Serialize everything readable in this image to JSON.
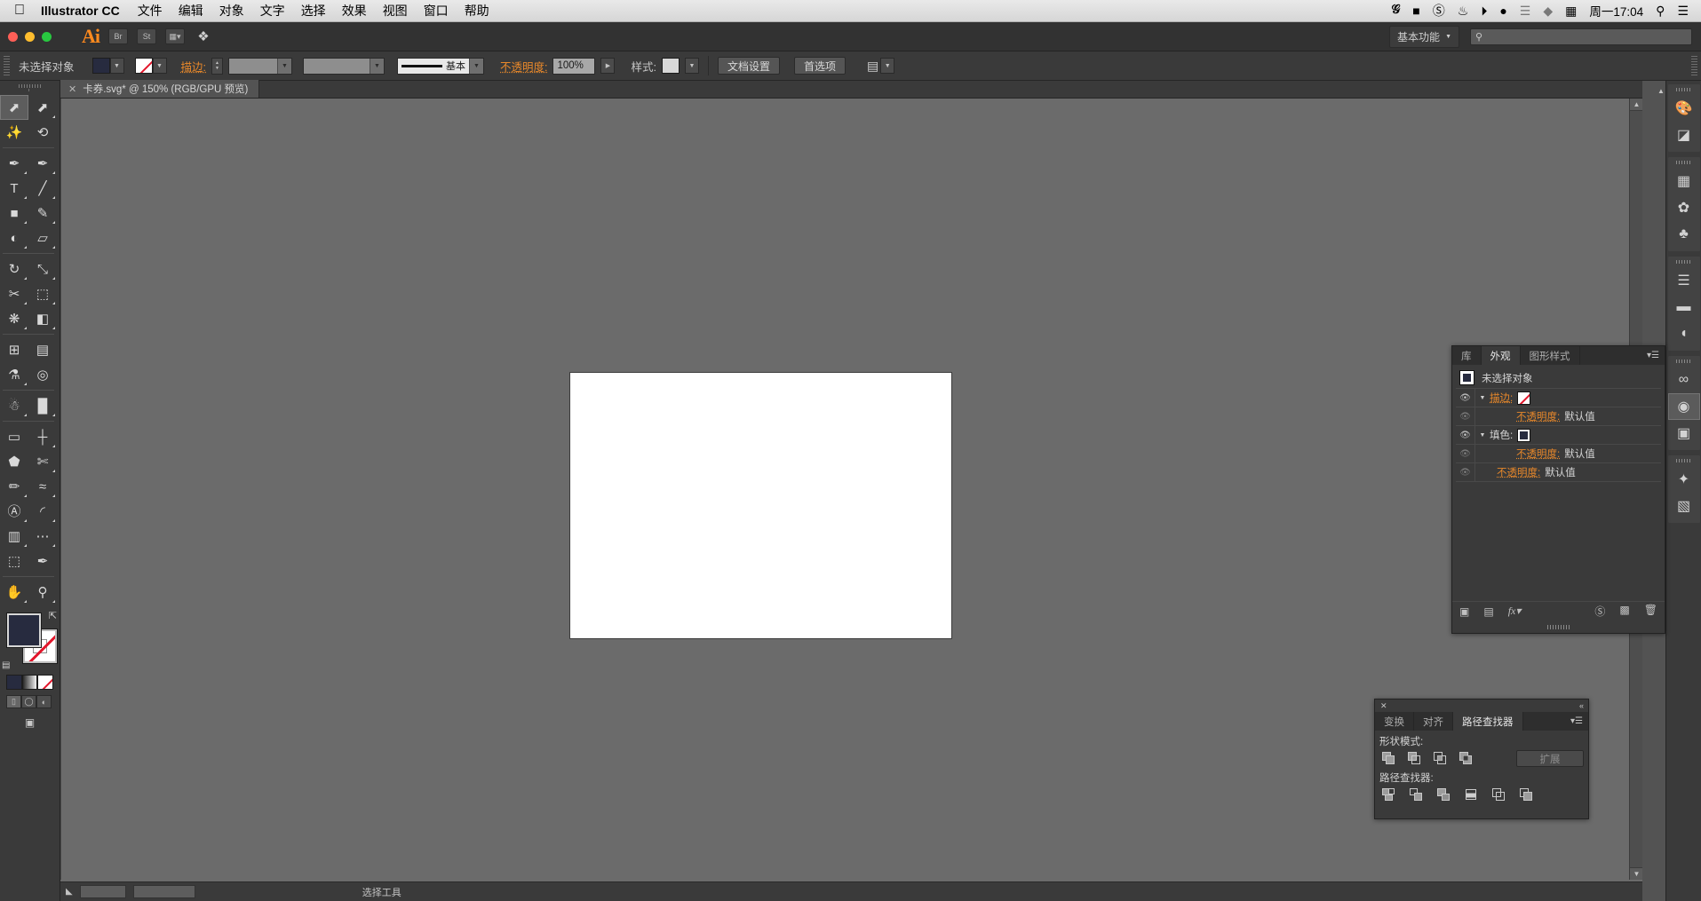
{
  "macos": {
    "apple_icon": "apple-logo",
    "app_name": "Illustrator CC",
    "menus": [
      "文件",
      "编辑",
      "对象",
      "文字",
      "选择",
      "效果",
      "视图",
      "窗口",
      "帮助"
    ],
    "status_icons": [
      "g-icon",
      "battery-icon",
      "no-entry-icon",
      "cloud-sync-icon",
      "display-icon",
      "qq-penguin-icon",
      "bluetooth-icon",
      "diamond-icon",
      "input-method-icon"
    ],
    "clock": "周一17:04",
    "search_icon": "search-icon",
    "control_center_icon": "list-icon"
  },
  "titlebar": {
    "logo": "Ai",
    "buttons": [
      "bridge-button",
      "stock-button",
      "arrange-button",
      "brush-button"
    ],
    "workspace_label": "基本功能",
    "workspace_caret": "chevron-down-icon",
    "search_placeholder": ""
  },
  "controlbar": {
    "selection_label": "未选择对象",
    "fill_swatch": "dark-navy",
    "stroke_swatch": "none",
    "stroke_label": "描边:",
    "stroke_weight": "",
    "stroke_profile": "",
    "brush_label": "基本",
    "opacity_label": "不透明度:",
    "opacity_value": "100%",
    "style_label": "样式:",
    "doc_setup_button": "文档设置",
    "preferences_button": "首选项",
    "align_button": "align-icon"
  },
  "tabbar": {
    "close_icon": "close-icon",
    "document_title": "卡券.svg* @ 150% (RGB/GPU 预览)"
  },
  "tools": {
    "rows": [
      [
        {
          "name": "selection-tool",
          "glyph": "selection",
          "selected": true,
          "corner": false
        },
        {
          "name": "direct-selection-tool",
          "glyph": "direct",
          "selected": false,
          "corner": true
        }
      ],
      [
        {
          "name": "magic-wand-tool",
          "glyph": "wand",
          "selected": false,
          "corner": false
        },
        {
          "name": "lasso-tool",
          "glyph": "lasso",
          "selected": false,
          "corner": false
        }
      ],
      [
        {
          "name": "pen-tool",
          "glyph": "pen",
          "selected": false,
          "corner": true
        },
        {
          "name": "curvature-tool",
          "glyph": "curvature",
          "selected": false,
          "corner": true
        }
      ],
      [
        {
          "name": "type-tool",
          "glyph": "type",
          "selected": false,
          "corner": true
        },
        {
          "name": "line-segment-tool",
          "glyph": "line",
          "selected": false,
          "corner": true
        }
      ],
      [
        {
          "name": "rectangle-tool",
          "glyph": "rect",
          "selected": false,
          "corner": true
        },
        {
          "name": "paintbrush-tool",
          "glyph": "brush",
          "selected": false,
          "corner": true
        }
      ],
      [
        {
          "name": "shaper-tool",
          "glyph": "shaper",
          "selected": false,
          "corner": true
        },
        {
          "name": "eraser-tool",
          "glyph": "eraser",
          "selected": false,
          "corner": true
        }
      ],
      [
        {
          "name": "rotate-tool",
          "glyph": "rotate",
          "selected": false,
          "corner": true
        },
        {
          "name": "scale-tool",
          "glyph": "scale",
          "selected": false,
          "corner": true
        }
      ],
      [
        {
          "name": "width-tool",
          "glyph": "width",
          "selected": false,
          "corner": true
        },
        {
          "name": "free-transform-tool",
          "glyph": "freetransform",
          "selected": false,
          "corner": true
        }
      ],
      [
        {
          "name": "shape-builder-tool",
          "glyph": "shapebuilder",
          "selected": false,
          "corner": true
        },
        {
          "name": "perspective-grid-tool",
          "glyph": "perspective",
          "selected": false,
          "corner": true
        }
      ],
      [
        {
          "name": "mesh-tool",
          "glyph": "mesh",
          "selected": false,
          "corner": false
        },
        {
          "name": "gradient-tool",
          "glyph": "gradient",
          "selected": false,
          "corner": false
        }
      ],
      [
        {
          "name": "eyedropper-tool",
          "glyph": "eyedropper",
          "selected": false,
          "corner": true
        },
        {
          "name": "blend-tool",
          "glyph": "blend",
          "selected": false,
          "corner": false
        }
      ],
      [
        {
          "name": "symbol-sprayer-tool",
          "glyph": "sprayer",
          "selected": false,
          "corner": true
        },
        {
          "name": "column-graph-tool",
          "glyph": "graph",
          "selected": false,
          "corner": true
        }
      ],
      [
        {
          "name": "artboard-tool",
          "glyph": "artboard",
          "selected": false,
          "corner": false
        },
        {
          "name": "slice-tool",
          "glyph": "slice",
          "selected": false,
          "corner": true
        }
      ],
      [
        {
          "name": "puppet-warp-tool",
          "glyph": "puppet",
          "selected": false,
          "corner": false
        },
        {
          "name": "scissors-tool",
          "glyph": "scissors",
          "selected": false,
          "corner": true
        }
      ],
      [
        {
          "name": "pencil-tool",
          "glyph": "pencil",
          "selected": false,
          "corner": true
        },
        {
          "name": "smooth-tool",
          "glyph": "smooth",
          "selected": false,
          "corner": true
        }
      ],
      [
        {
          "name": "area-type-tool",
          "glyph": "areatype",
          "selected": false,
          "corner": true
        },
        {
          "name": "arc-tool",
          "glyph": "arc",
          "selected": false,
          "corner": true
        }
      ],
      [
        {
          "name": "slice-select-tool",
          "glyph": "sliceselect",
          "selected": false,
          "corner": true
        },
        {
          "name": "measure-tool",
          "glyph": "measure",
          "selected": false,
          "corner": true
        }
      ],
      [
        {
          "name": "crop-tool",
          "glyph": "crop",
          "selected": false,
          "corner": false
        },
        {
          "name": "knife-tool",
          "glyph": "knife",
          "selected": false,
          "corner": false
        }
      ],
      [
        {
          "name": "hand-tool",
          "glyph": "hand",
          "selected": false,
          "corner": true
        },
        {
          "name": "zoom-tool",
          "glyph": "zoom",
          "selected": false,
          "corner": true
        }
      ]
    ],
    "fill_label": "fill-proxy",
    "stroke_label": "stroke-proxy",
    "swap_icon": "swap-fill-stroke-icon",
    "default_icon": "default-fill-stroke-icon",
    "color_modes": [
      "color-mode",
      "gradient-mode",
      "none-mode"
    ],
    "draw_modes": [
      "draw-normal",
      "draw-behind",
      "draw-inside"
    ],
    "screen_mode": "screen-mode-icon"
  },
  "dockrail": {
    "collapse_icon": "collapse-icon",
    "groups": [
      [
        "color-icon",
        "color-guide-icon"
      ],
      [
        "swatches-icon",
        "brushes-icon",
        "symbols-icon"
      ],
      [
        "stroke-icon",
        "gradient-icon",
        "transparency-icon"
      ],
      [
        "cc-libraries-icon",
        "appearance-icon",
        "graphic-styles-icon"
      ],
      [
        "layers-icon",
        "artboards-icon"
      ]
    ],
    "active": "appearance-icon"
  },
  "appearance_panel": {
    "tabs": [
      {
        "label": "库",
        "active": false
      },
      {
        "label": "外观",
        "active": true
      },
      {
        "label": "图形样式",
        "active": false
      }
    ],
    "menu_icon": "panel-menu-icon",
    "header": {
      "swatch": "dark-navy-swatch",
      "title": "未选择对象"
    },
    "rows": [
      {
        "eye": "eye-icon",
        "eye_dim": false,
        "triangle": "triangle-down-icon",
        "label": "描边:",
        "label_orange": true,
        "value": "",
        "chip": "none-chip",
        "indent": 0
      },
      {
        "eye": "eye-icon",
        "eye_dim": true,
        "triangle": "",
        "label": "不透明度:",
        "label_orange": true,
        "value": "默认值",
        "chip": "",
        "indent": 2
      },
      {
        "eye": "eye-icon",
        "eye_dim": false,
        "triangle": "triangle-down-icon",
        "label": "填色:",
        "label_orange": false,
        "value": "",
        "chip": "dark-chip",
        "indent": 0
      },
      {
        "eye": "eye-icon",
        "eye_dim": true,
        "triangle": "",
        "label": "不透明度:",
        "label_orange": true,
        "value": "默认值",
        "chip": "",
        "indent": 2
      },
      {
        "eye": "eye-icon",
        "eye_dim": true,
        "triangle": "",
        "label": "不透明度:",
        "label_orange": true,
        "value": "默认值",
        "chip": "",
        "indent": 1
      }
    ],
    "footer_icons": [
      "add-new-stroke-icon",
      "add-new-fill-icon",
      "fx-icon",
      "clear-appearance-icon",
      "duplicate-item-icon",
      "delete-item-icon"
    ]
  },
  "pathfinder_panel": {
    "close_icon": "close-icon",
    "collapse_icon": "collapse-panel-icon",
    "tabs": [
      {
        "label": "变换",
        "active": false
      },
      {
        "label": "对齐",
        "active": false
      },
      {
        "label": "路径查找器",
        "active": true
      }
    ],
    "menu_icon": "panel-menu-icon",
    "shape_modes_label": "形状模式:",
    "shape_mode_buttons": [
      "unite-icon",
      "minus-front-icon",
      "intersect-icon",
      "exclude-icon"
    ],
    "expand_button": "扩展",
    "pathfinders_label": "路径查找器:",
    "pathfinder_buttons": [
      "divide-icon",
      "trim-icon",
      "merge-icon",
      "crop-icon",
      "outline-icon",
      "minus-back-icon"
    ]
  },
  "canvas": {
    "artboard_color": "#ffffff",
    "background_color": "#6b6b6b"
  },
  "statusbar": {
    "zoom_value": "",
    "tool_label": "选择工具"
  },
  "colors": {
    "accent_orange": "#e8882a",
    "chrome_dark": "#3a3a3a",
    "canvas_gray": "#6b6b6b",
    "panel_bg": "#3a3a3a"
  }
}
